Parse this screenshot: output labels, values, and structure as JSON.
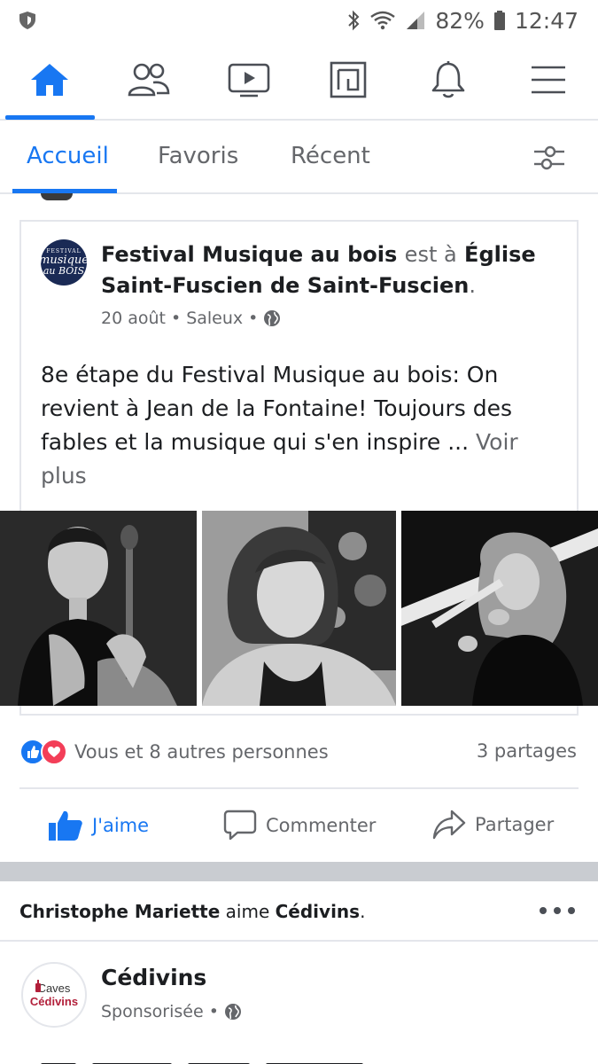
{
  "status_bar": {
    "battery": "82%",
    "time": "12:47"
  },
  "nav": {
    "items": [
      {
        "name": "home-icon",
        "active": true
      },
      {
        "name": "friends-icon"
      },
      {
        "name": "watch-icon"
      },
      {
        "name": "marketplace-icon"
      },
      {
        "name": "notifications-icon"
      },
      {
        "name": "menu-icon"
      }
    ],
    "accent": "#1877f2"
  },
  "tabs": {
    "home": "Accueil",
    "favorites": "Favoris",
    "recent": "Récent"
  },
  "post": {
    "avatar_lines": [
      "FESTIVAL",
      "musique",
      "au BOIS"
    ],
    "author": "Festival Musique au bois",
    "connector": "est à",
    "place": "Église Saint-Fuscien de Saint-Fuscien",
    "date": "20 août",
    "location": "Saleux",
    "text": "8e étape du Festival Musique au bois: On revient à Jean de la Fontaine! Toujours des fables et la musique qui s'en inspire ...",
    "see_more": "Voir plus",
    "reactions_text": "Vous et 8 autres personnes",
    "shares": "3 partages",
    "actions": {
      "like": "J'aime",
      "comment": "Commenter",
      "share": "Partager"
    }
  },
  "story2": {
    "actor": "Christophe Mariette",
    "verb": "aime",
    "object": "Cédivins",
    "page_name": "Cédivins",
    "avatar_lines": [
      "Caves",
      "Cédivins"
    ],
    "sponsored": "Sponsorisée"
  }
}
